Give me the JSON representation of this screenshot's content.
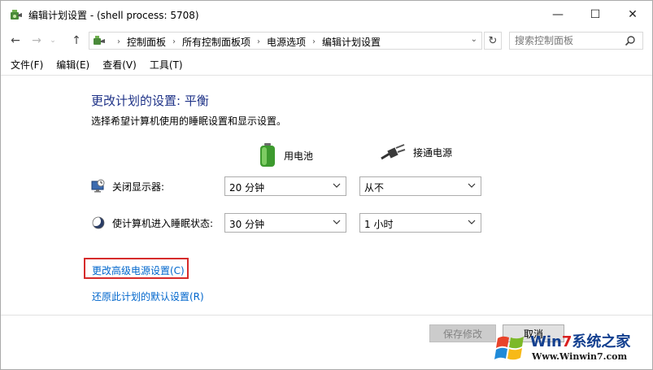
{
  "window": {
    "title": "编辑计划设置 - (shell process: 5708)",
    "minimize_glyph": "—",
    "maximize_glyph": "☐",
    "close_glyph": "✕"
  },
  "nav": {
    "back_glyph": "←",
    "forward_glyph": "→",
    "recent_glyph": "⌄",
    "up_glyph": "↑",
    "refresh_glyph": "↻",
    "breadcrumbs": [
      "控制面板",
      "所有控制面板项",
      "电源选项",
      "编辑计划设置"
    ],
    "breadcrumb_sep": "›",
    "search_placeholder": "搜索控制面板"
  },
  "menu": [
    "文件(F)",
    "编辑(E)",
    "查看(V)",
    "工具(T)"
  ],
  "content": {
    "heading": "更改计划的设置: 平衡",
    "subheading": "选择希望计算机使用的睡眠设置和显示设置。",
    "columns": {
      "battery": "用电池",
      "plugged_in": "接通电源"
    },
    "rows": [
      {
        "label": "关闭显示器:",
        "icon": "monitor-icon",
        "battery": "20 分钟",
        "plugged_in": "从不"
      },
      {
        "label": "使计算机进入睡眠状态:",
        "icon": "moon-icon",
        "battery": "30 分钟",
        "plugged_in": "1 小时"
      }
    ],
    "advanced_link": "更改高级电源设置(C)",
    "restore_link": "还原此计划的默认设置(R)"
  },
  "buttons": {
    "save": "保存修改",
    "cancel": "取消"
  },
  "watermark": {
    "brand_prefix": "Win",
    "brand_seven": "7",
    "brand_suffix": "系统之家",
    "url": "Www.Winwin7.com"
  },
  "colors": {
    "heading": "#1e3287",
    "link": "#0066cc",
    "highlight": "#d62b2b"
  }
}
